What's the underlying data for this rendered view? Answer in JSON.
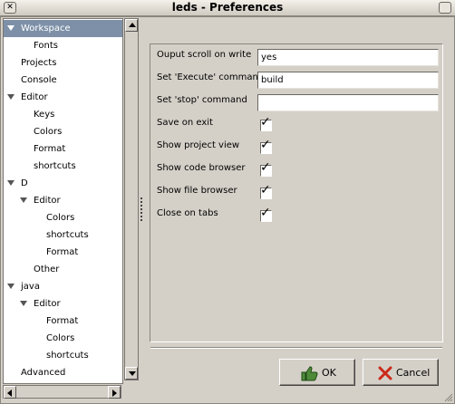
{
  "window": {
    "title": "leds - Preferences"
  },
  "tree": {
    "items": [
      {
        "label": "Workspace",
        "depth": 0,
        "expanded": true,
        "selected": true
      },
      {
        "label": "Fonts",
        "depth": 1
      },
      {
        "label": "Projects",
        "depth": 0
      },
      {
        "label": "Console",
        "depth": 0
      },
      {
        "label": "Editor",
        "depth": 0,
        "expanded": true
      },
      {
        "label": "Keys",
        "depth": 1
      },
      {
        "label": "Colors",
        "depth": 1
      },
      {
        "label": "Format",
        "depth": 1
      },
      {
        "label": "shortcuts",
        "depth": 1
      },
      {
        "label": "D",
        "depth": 0,
        "expanded": true
      },
      {
        "label": "Editor",
        "depth": 1,
        "expanded": true
      },
      {
        "label": "Colors",
        "depth": 2
      },
      {
        "label": "shortcuts",
        "depth": 2
      },
      {
        "label": "Format",
        "depth": 2
      },
      {
        "label": "Other",
        "depth": 1
      },
      {
        "label": "java",
        "depth": 0,
        "expanded": true
      },
      {
        "label": "Editor",
        "depth": 1,
        "expanded": true
      },
      {
        "label": "Format",
        "depth": 2
      },
      {
        "label": "Colors",
        "depth": 2
      },
      {
        "label": "shortcuts",
        "depth": 2
      },
      {
        "label": "Advanced",
        "depth": 0
      }
    ]
  },
  "options": {
    "output_scroll": {
      "label": "Ouput scroll on write",
      "value": "yes"
    },
    "execute_command": {
      "label": "Set 'Execute' command",
      "value": "build"
    },
    "stop_command": {
      "label": "Set 'stop' command",
      "value": ""
    },
    "save_on_exit": {
      "label": "Save on exit",
      "checked": true
    },
    "show_project_view": {
      "label": "Show project view",
      "checked": true
    },
    "show_code_browser": {
      "label": "Show code browser",
      "checked": true
    },
    "show_file_browser": {
      "label": "Show file browser",
      "checked": true
    },
    "close_on_tabs": {
      "label": "Close on tabs",
      "checked": true
    }
  },
  "buttons": {
    "ok": "OK",
    "cancel": "Cancel"
  },
  "colors": {
    "selection": "#7d90a8",
    "background": "#d4d0c8",
    "ok_icon": "#4f8a3a",
    "cancel_icon": "#cc2a1a"
  },
  "icons": {
    "window_menu": "window-menu-icon",
    "ok": "thumbs-up-icon",
    "cancel": "red-x-icon"
  }
}
